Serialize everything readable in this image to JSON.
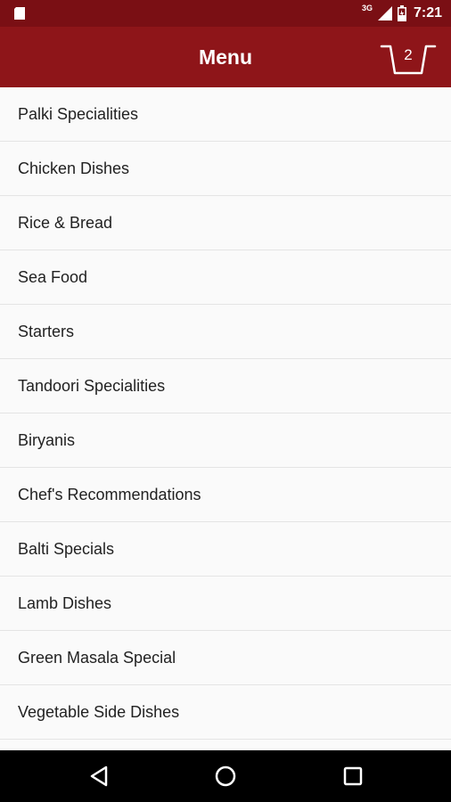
{
  "status_bar": {
    "left_icon": "sd-card-icon",
    "network_label": "3G",
    "time": "7:21"
  },
  "app_bar": {
    "title": "Menu",
    "cart_count": "2",
    "cart_icon": "basket-icon"
  },
  "menu": {
    "items": [
      {
        "label": "Palki Specialities"
      },
      {
        "label": "Chicken Dishes"
      },
      {
        "label": "Rice & Bread"
      },
      {
        "label": "Sea Food"
      },
      {
        "label": "Starters"
      },
      {
        "label": "Tandoori Specialities"
      },
      {
        "label": "Biryanis"
      },
      {
        "label": "Chef's Recommendations"
      },
      {
        "label": "Balti Specials"
      },
      {
        "label": "Lamb Dishes"
      },
      {
        "label": "Green Masala Special"
      },
      {
        "label": "Vegetable Side Dishes"
      },
      {
        "label": ""
      }
    ]
  },
  "nav_bar": {
    "back_icon": "back-triangle-icon",
    "home_icon": "home-circle-icon",
    "recents_icon": "recents-square-icon"
  },
  "colors": {
    "status_bar": "#7a0f14",
    "app_bar": "#8e1519",
    "background": "#fafafa",
    "nav_bar": "#000000"
  }
}
